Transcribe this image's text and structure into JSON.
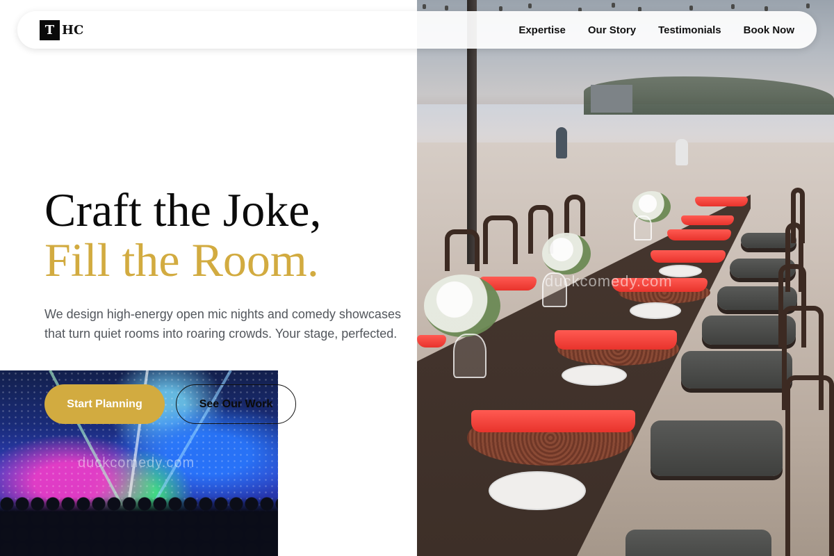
{
  "brand": {
    "mark": "T",
    "text": "HC"
  },
  "nav": {
    "items": [
      {
        "label": "Expertise"
      },
      {
        "label": "Our Story"
      },
      {
        "label": "Testimonials"
      },
      {
        "label": "Book Now"
      }
    ]
  },
  "hero": {
    "title_line1": "Craft the Joke,",
    "title_line2": "Fill the Room.",
    "description": "We design high-energy open mic nights and comedy showcases that turn quiet rooms into roaring crowds. Your stage, perfected.",
    "primary_cta": "Start Planning",
    "secondary_cta": "See Our Work"
  },
  "images": {
    "main_photo_watermark": "duckcomedy.com",
    "concert_watermark": "duckcomedy.com"
  },
  "colors": {
    "accent": "#d2ab40",
    "text_dark": "#0b0b0b",
    "text_muted": "#52565c"
  }
}
